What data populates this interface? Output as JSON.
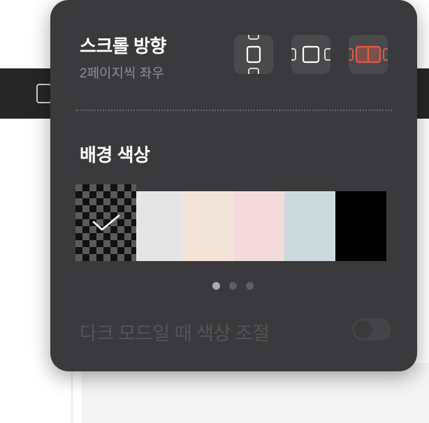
{
  "scroll_direction": {
    "title": "스크롤 방향",
    "current_value": "2페이지씩 좌우",
    "modes": [
      {
        "icon": "vertical-scroll-icon",
        "selected": false
      },
      {
        "icon": "horizontal-single-page-icon",
        "selected": false
      },
      {
        "icon": "horizontal-two-page-icon",
        "selected": true
      }
    ]
  },
  "background_color": {
    "title": "배경 색상",
    "swatches": [
      {
        "name": "checker",
        "color": "",
        "selected": true
      },
      {
        "name": "light-gray",
        "color": "#e5e5e5",
        "selected": false
      },
      {
        "name": "cream",
        "color": "#f3e4da",
        "selected": false
      },
      {
        "name": "pink",
        "color": "#f1dbdc",
        "selected": false
      },
      {
        "name": "light-blue",
        "color": "#ccdade",
        "selected": false
      },
      {
        "name": "black",
        "color": "#000000",
        "selected": false
      }
    ],
    "pages_total": 3,
    "page_active": 1
  },
  "dark_mode_adjust": {
    "label": "다크 모드일 때 색상 조절",
    "enabled": false,
    "disabled": true
  },
  "colors": {
    "panel_bg": "#3a3a3c",
    "accent_selected": "#e0594b"
  }
}
